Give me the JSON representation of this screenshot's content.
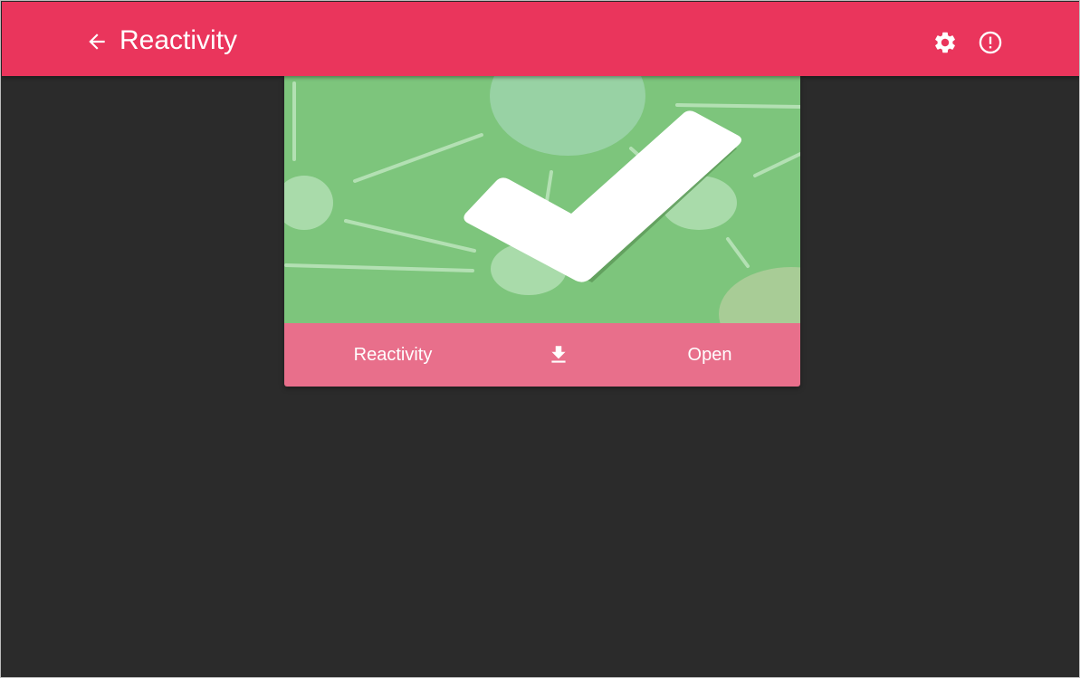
{
  "app_bar": {
    "title": "Reactivity",
    "back_icon": "arrow-left-icon",
    "settings_icon": "gear-icon",
    "info_icon": "alert-circle-icon",
    "background_color": "#ea355c"
  },
  "card": {
    "title": "Reactivity",
    "image_icon": "checkmark-icon",
    "image_background_color": "#7dc57c",
    "download_icon": "download-icon",
    "open_label": "Open",
    "footer_color": "#e86f8b"
  },
  "page": {
    "background_color": "#2b2b2b"
  }
}
